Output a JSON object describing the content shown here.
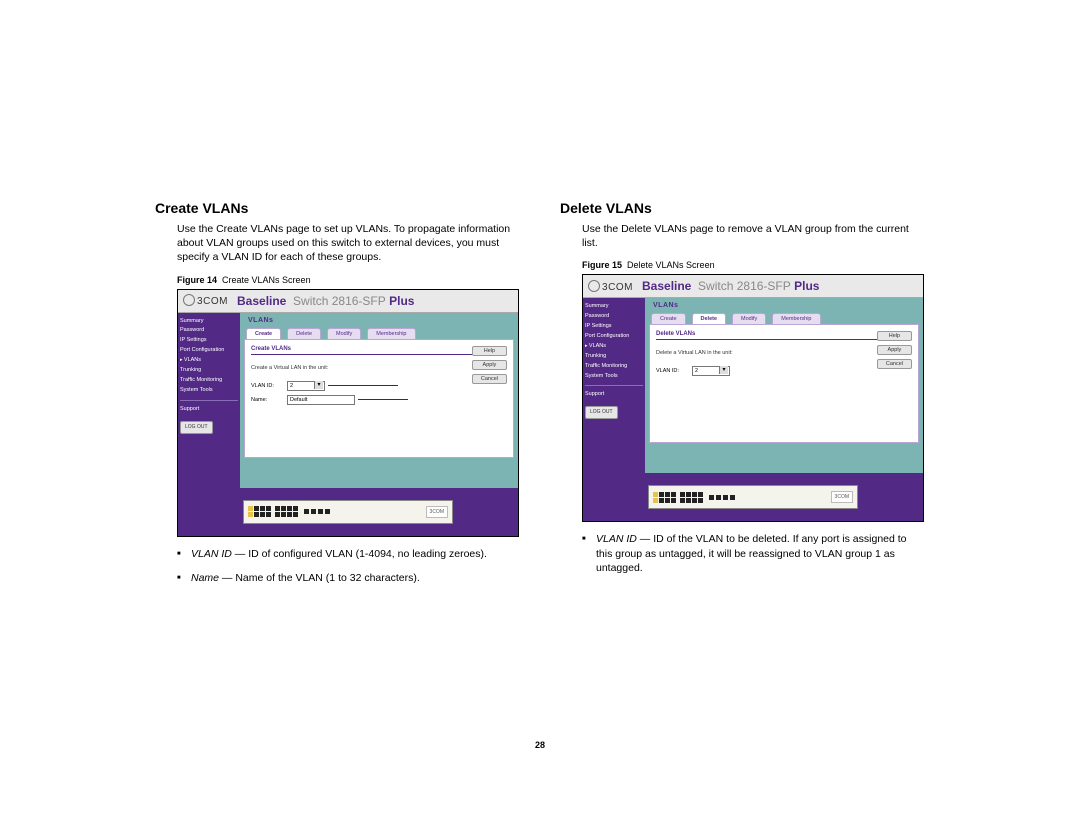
{
  "page_number": "28",
  "left": {
    "heading": "Create VLANs",
    "intro": "Use the Create VLANs page to set up VLANs. To propagate information about VLAN groups used on this switch to external devices, you must specify a VLAN ID for each of these groups.",
    "figure_label": "Figure 14",
    "figure_title": "Create VLANs Screen",
    "bullets": [
      {
        "term": "VLAN ID",
        "desc": " — ID of configured VLAN (1-4094, no leading zeroes)."
      },
      {
        "term": "Name",
        "desc": " — Name of the VLAN (1 to 32 characters)."
      }
    ]
  },
  "right": {
    "heading": "Delete VLANs",
    "intro": "Use the Delete VLANs page to remove a VLAN group from the current list.",
    "figure_label": "Figure 15",
    "figure_title": "Delete VLANs Screen",
    "bullets": [
      {
        "term": "VLAN ID",
        "desc": " — ID of the VLAN to be deleted. If any port is assigned to this group as untagged, it will be reassigned to VLAN group 1 as untagged."
      }
    ]
  },
  "screenshot": {
    "logo": "3COM",
    "banner_bold": "Baseline",
    "banner_thin": "Switch 2816-SFP",
    "banner_plus": "Plus",
    "breadcrumb": "VLANs",
    "sidebar": [
      "Summary",
      "Password",
      "IP Settings",
      "Port Configuration",
      "VLANs",
      "Trunking",
      "Traffic Monitoring",
      "System Tools"
    ],
    "sidebar_support": "Support",
    "logout": "LOG OUT",
    "tabs": [
      "Create",
      "Delete",
      "Modify",
      "Membership"
    ],
    "buttons": {
      "help": "Help",
      "apply": "Apply",
      "cancel": "Cancel"
    },
    "portlogo": "3COM",
    "create": {
      "panel_title": "Create VLANs",
      "panel_desc": "Create a Virtual LAN in the unit:",
      "vlanid_label": "VLAN ID:",
      "vlanid_value": "2",
      "name_label": "Name:",
      "name_value": "Default"
    },
    "delete": {
      "panel_title": "Delete VLANs",
      "panel_desc": "Delete a Virtual LAN in the unit:",
      "vlanid_label": "VLAN ID:",
      "vlanid_value": "2"
    }
  }
}
